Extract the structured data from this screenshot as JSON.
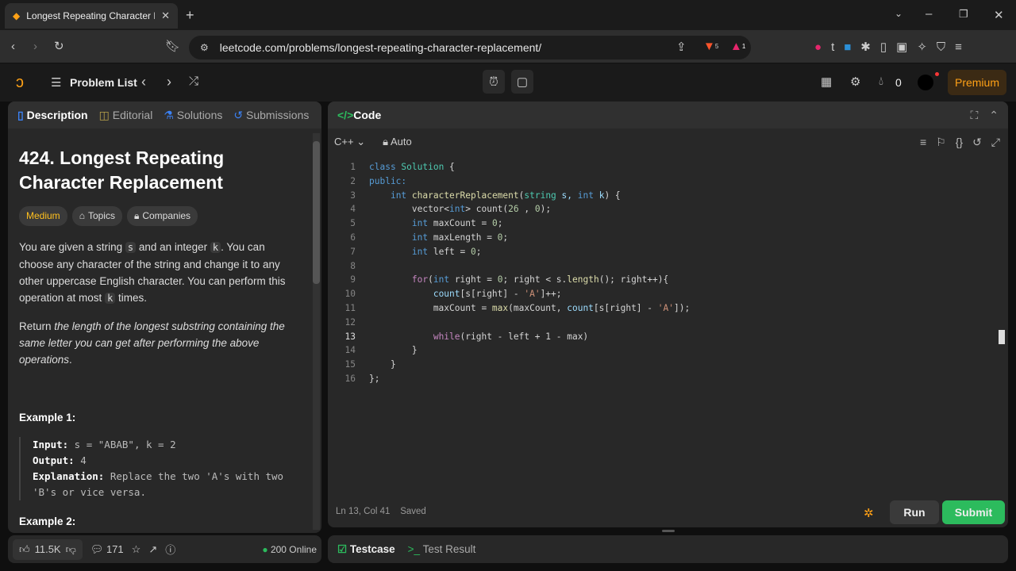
{
  "browser": {
    "tab_title": "Longest Repeating Character Replacement - LeetCode",
    "tab_title_visible": "Longest Repeating Character R",
    "url": "leetcode.com/problems/longest-repeating-character-replacement/",
    "brave_badge": "5",
    "alert_badge": "1"
  },
  "nav": {
    "problem_list": "Problem List",
    "streak": "0",
    "premium": "Premium"
  },
  "left": {
    "tabs": [
      "Description",
      "Editorial",
      "Solutions",
      "Submissions"
    ],
    "title": "424. Longest Repeating Character Replacement",
    "difficulty": "Medium",
    "topics": "Topics",
    "companies": "Companies",
    "p1": [
      "You are given a string ",
      "s",
      " and an integer ",
      "k",
      ". You can choose any character of the string and change it to any other uppercase English character. You can perform this operation at most ",
      "k",
      " times."
    ],
    "p2": [
      "Return ",
      "the length of the longest substring containing the same letter you can get after performing the above operations",
      "."
    ],
    "example1_title": "Example 1:",
    "ex1": {
      "input_label": "Input:",
      "input": " s = \"ABAB\", k = 2",
      "output_label": "Output:",
      "output": " 4",
      "expl_label": "Explanation:",
      "expl": " Replace the two 'A's with two 'B's or vice versa."
    },
    "example2_title": "Example 2:",
    "footer": {
      "likes": "11.5K",
      "comments": "171",
      "online": "200 Online"
    }
  },
  "editor": {
    "title": "Code",
    "language": "C++",
    "mode": "Auto",
    "status": "Ln 13, Col 41",
    "saved": "Saved",
    "run": "Run",
    "submit": "Submit",
    "lines": [
      [
        [
          "class ",
          "kw"
        ],
        [
          "Solution",
          "ty"
        ],
        [
          " {",
          ""
        ]
      ],
      [
        [
          "public:",
          "kw"
        ]
      ],
      [
        [
          "    ",
          ""
        ],
        [
          "int ",
          "kw"
        ],
        [
          "characterReplacement",
          "fn"
        ],
        [
          "(",
          ""
        ],
        [
          "string ",
          "ty"
        ],
        [
          "s, ",
          "va"
        ],
        [
          "int ",
          "kw"
        ],
        [
          "k",
          "va"
        ],
        [
          ") {",
          ""
        ]
      ],
      [
        [
          "        vector<",
          ""
        ],
        [
          "int",
          "kw"
        ],
        [
          "> count(",
          ""
        ],
        [
          "26",
          "nu"
        ],
        [
          " , ",
          ""
        ],
        [
          "0",
          "nu"
        ],
        [
          ");",
          ""
        ]
      ],
      [
        [
          "        ",
          ""
        ],
        [
          "int ",
          "kw"
        ],
        [
          "maxCount = ",
          ""
        ],
        [
          "0",
          "nu"
        ],
        [
          ";",
          ""
        ]
      ],
      [
        [
          "        ",
          ""
        ],
        [
          "int ",
          "kw"
        ],
        [
          "maxLength = ",
          ""
        ],
        [
          "0",
          "nu"
        ],
        [
          ";",
          ""
        ]
      ],
      [
        [
          "        ",
          ""
        ],
        [
          "int ",
          "kw"
        ],
        [
          "left = ",
          ""
        ],
        [
          "0",
          "nu"
        ],
        [
          ";",
          ""
        ]
      ],
      [
        [
          "",
          ""
        ]
      ],
      [
        [
          "        ",
          ""
        ],
        [
          "for",
          "ctl"
        ],
        [
          "(",
          ""
        ],
        [
          "int ",
          "kw"
        ],
        [
          "right = ",
          ""
        ],
        [
          "0",
          "nu"
        ],
        [
          "; right < s.",
          ""
        ],
        [
          "length",
          "fn"
        ],
        [
          "(); right++){",
          ""
        ]
      ],
      [
        [
          "            ",
          ""
        ],
        [
          "count",
          "va"
        ],
        [
          "[s[right] - ",
          ""
        ],
        [
          "'A'",
          "st"
        ],
        [
          "]++;",
          ""
        ]
      ],
      [
        [
          "            maxCount = ",
          ""
        ],
        [
          "max",
          "fn"
        ],
        [
          "(maxCount, ",
          ""
        ],
        [
          "count",
          "va"
        ],
        [
          "[s[right] - ",
          ""
        ],
        [
          "'A'",
          "st"
        ],
        [
          "]);",
          ""
        ]
      ],
      [
        [
          "",
          ""
        ]
      ],
      [
        [
          "            ",
          ""
        ],
        [
          "while",
          "ctl"
        ],
        [
          "(right - left + 1 - max)",
          ""
        ]
      ],
      [
        [
          "        }",
          ""
        ]
      ],
      [
        [
          "    }",
          ""
        ]
      ],
      [
        [
          "};",
          ""
        ]
      ]
    ]
  },
  "bottom": {
    "testcase": "Testcase",
    "test_result": "Test Result"
  },
  "colors": {
    "accent_green": "#2cbb5d",
    "premium": "#ffa116",
    "medium": "#ffc01e"
  }
}
